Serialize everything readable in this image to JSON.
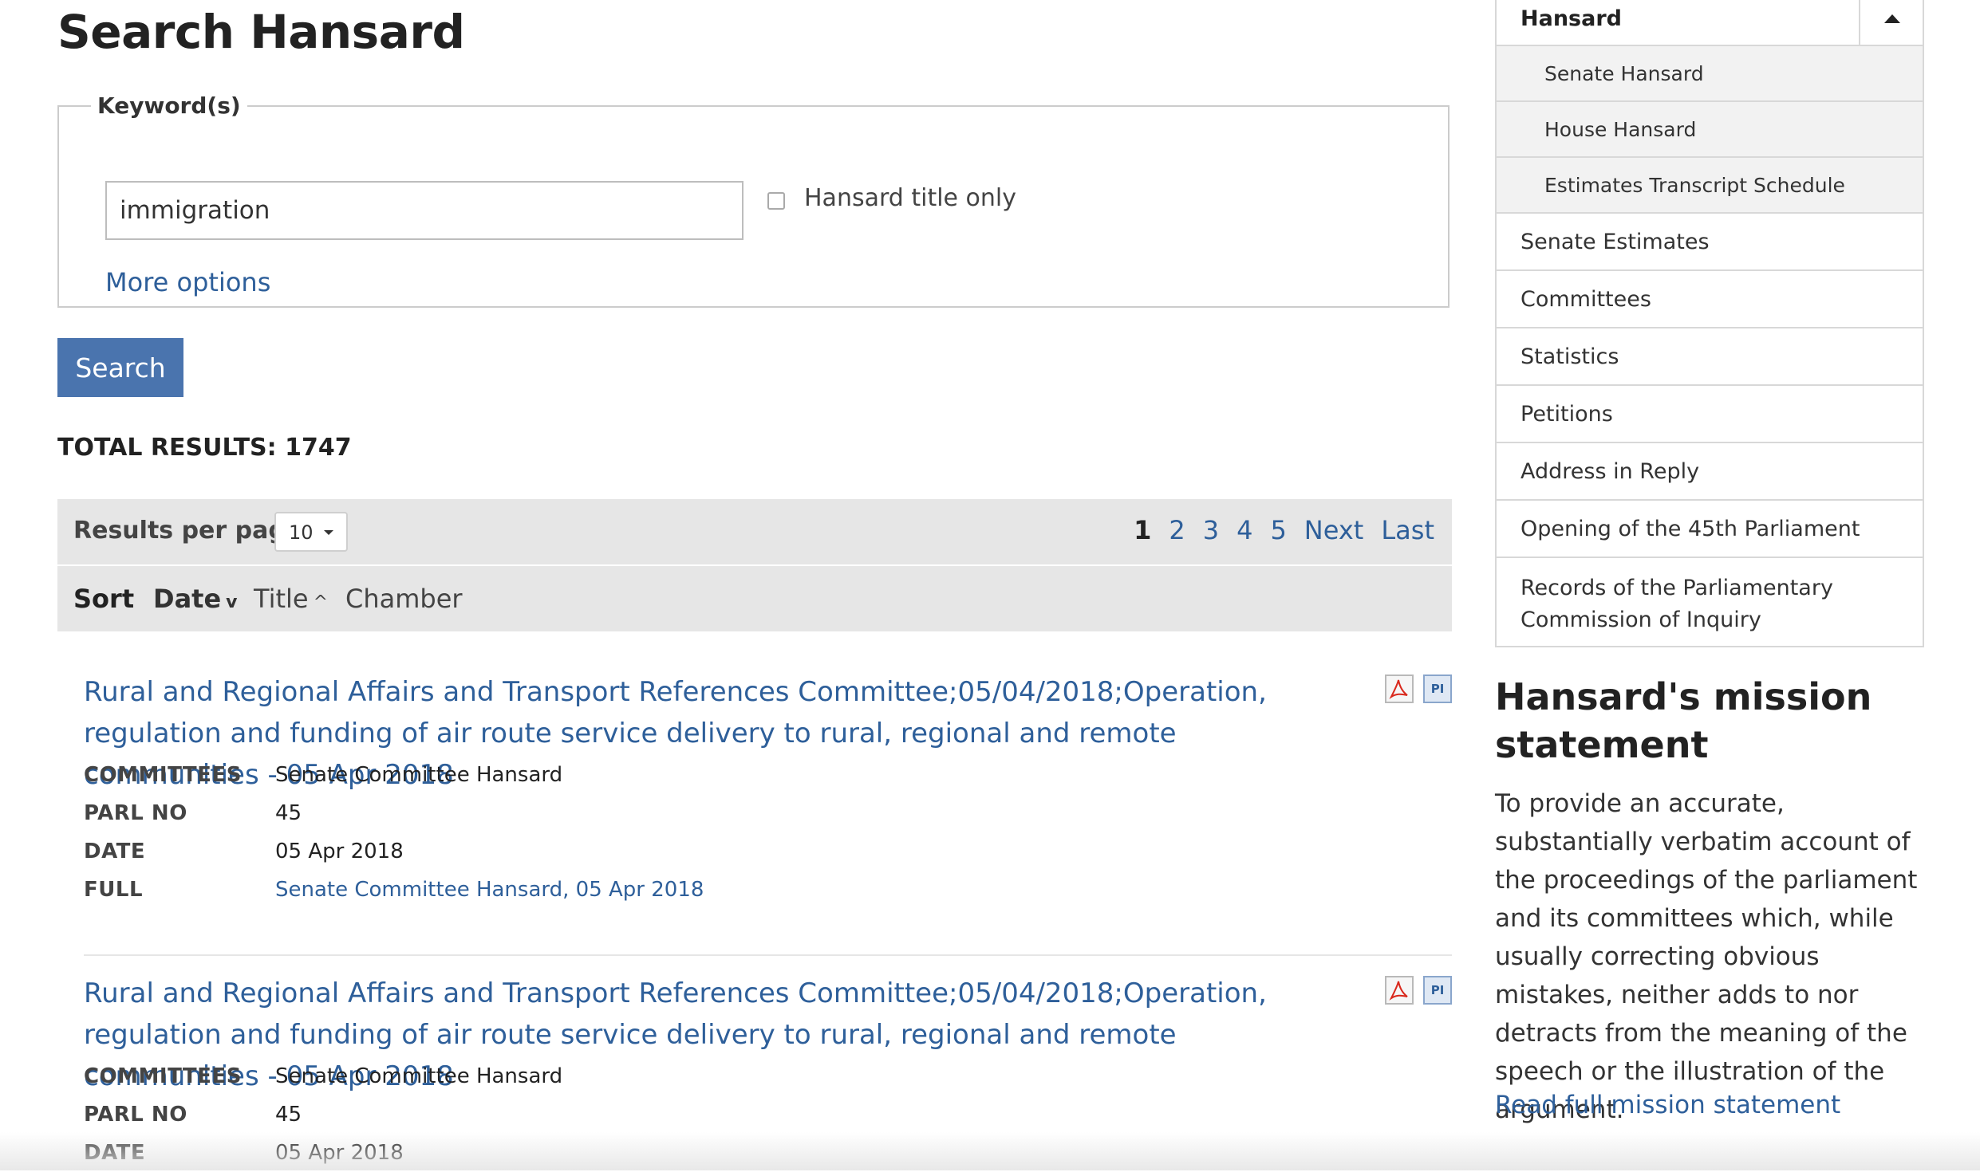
{
  "page": {
    "title": "Search Hansard"
  },
  "search": {
    "legend": "Keyword(s)",
    "keyword_value": "immigration",
    "title_only_label": "Hansard title only",
    "title_only_checked": false,
    "more_options": "More options",
    "button_label": "Search"
  },
  "results": {
    "total_label": "TOTAL RESULTS: 1747",
    "per_page_label": "Results per page",
    "per_page_value": "10",
    "pagination": {
      "current": "1",
      "pages": [
        "2",
        "3",
        "4",
        "5"
      ],
      "next": "Next",
      "last": "Last"
    },
    "sort": {
      "label": "Sort",
      "date": "Date",
      "date_arrow": "v",
      "title": "Title",
      "title_arrow": "^",
      "chamber": "Chamber"
    },
    "field_labels": {
      "committees": "COMMITTEES",
      "parl_no": "PARL NO",
      "date": "DATE",
      "full": "FULL"
    },
    "items": [
      {
        "title": "Rural and Regional Affairs and Transport References Committee;05/04/2018;Operation, regulation and funding of air route service delivery to rural, regional and remote communities - 05 Apr 2018",
        "committees": "Senate Committee Hansard",
        "parl_no": "45",
        "date": "05 Apr 2018",
        "full": "Senate Committee Hansard, 05 Apr 2018",
        "icons": [
          "pdf-icon",
          "pi-icon"
        ],
        "pi_text": "PI"
      },
      {
        "title": "Rural and Regional Affairs and Transport References Committee;05/04/2018;Operation, regulation and funding of air route service delivery to rural, regional and remote communities - 05 Apr 2018",
        "committees": "Senate Committee Hansard",
        "parl_no": "45",
        "date": "05 Apr 2018",
        "icons": [
          "pdf-icon",
          "pi-icon"
        ],
        "pi_text": "PI"
      }
    ]
  },
  "sidebar": {
    "nav_header": "Hansard",
    "nav_toggle_icon": "caret-up-icon",
    "sub_items": [
      "Senate Hansard",
      "House Hansard",
      "Estimates Transcript Schedule"
    ],
    "items": [
      "Senate Estimates",
      "Committees",
      "Statistics",
      "Petitions",
      "Address in Reply",
      "Opening of the 45th Parliament",
      "Records of the Parliamentary Commission of Inquiry"
    ],
    "mission": {
      "title": "Hansard's mission statement",
      "text": "To provide an accurate, substantially verbatim account of the proceedings of the parliament and its committees which, while usually correcting obvious mistakes, neither adds to nor detracts from the meaning of the speech or the illustration of the argument.",
      "link": "Read full mission statement"
    }
  },
  "colors": {
    "link": "#2e5f9a",
    "button": "#4a74ae",
    "bar_bg": "#e6e6e6",
    "sub_nav_bg": "#f2f2f2",
    "pdf_red": "#d9281c"
  }
}
